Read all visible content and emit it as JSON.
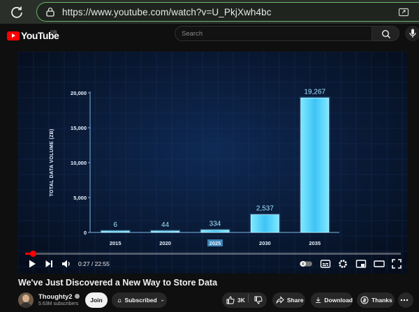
{
  "browser": {
    "url": "https://www.youtube.com/watch?v=U_PkjXwh4bc"
  },
  "youtube": {
    "logo_text": "YouTube",
    "region": "GB",
    "search_placeholder": "Search"
  },
  "video": {
    "title": "We've Just Discovered a New Way to Store Data",
    "time_current": "0:27",
    "time_total": "22:55",
    "time_display": "0:27 / 22:55",
    "progress": 0.0196
  },
  "channel": {
    "name": "Thoughty2",
    "subscribers": "5.63M subscribers",
    "join_label": "Join",
    "subscribed_label": "Subscribed"
  },
  "actions": {
    "likes": "3K",
    "share": "Share",
    "download": "Download",
    "thanks": "Thanks"
  },
  "chart_data": {
    "type": "bar",
    "categories": [
      "2015",
      "2020",
      "2025",
      "2030",
      "2035"
    ],
    "values": [
      6,
      44,
      334,
      2537,
      19267
    ],
    "value_labels": [
      "6",
      "44",
      "334",
      "2,537",
      "19,267"
    ],
    "ylabel": "TOTAL DATA VOLUME (ZB)",
    "ylim": [
      0,
      20000
    ],
    "yticks": [
      0,
      5000,
      10000,
      15000,
      20000
    ],
    "ytick_labels": [
      "0",
      "5,000",
      "10,000",
      "15,000",
      "20,000"
    ],
    "highlighted_category": "2025",
    "grid": true,
    "bar_color": "#4fd8ff",
    "background_color": "#0a1a33"
  }
}
